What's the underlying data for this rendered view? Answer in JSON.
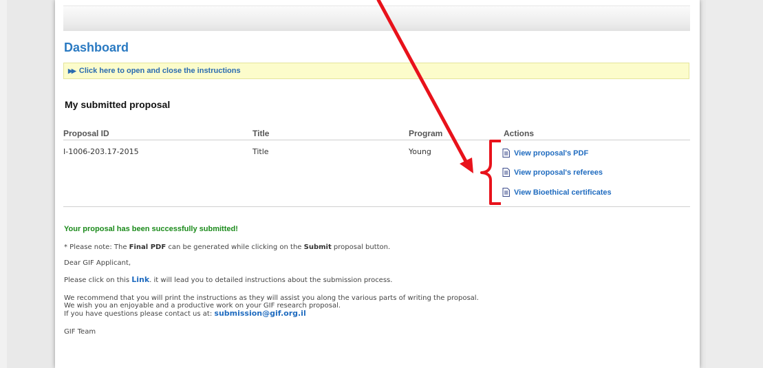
{
  "dashboard": {
    "title": "Dashboard",
    "instructions_toggle": "Click here to open and close the instructions"
  },
  "proposal_section": {
    "title": "My submitted proposal",
    "columns": [
      "Proposal ID",
      "Title",
      "Program",
      "Actions"
    ],
    "row": {
      "id": "I-1006-203.17-2015",
      "title": "Title",
      "program": "Young"
    },
    "actions": [
      {
        "label": "View proposal's PDF",
        "icon": "document-icon"
      },
      {
        "label": "View proposal's referees",
        "icon": "document-icon"
      },
      {
        "label": "View Bioethical certificates",
        "icon": "document-icon"
      }
    ]
  },
  "messages": {
    "success": "Your proposal has been successfully submitted!",
    "note_prefix": "* Please note: The ",
    "note_final_pdf": "Final PDF",
    "note_middle": " can be generated while clicking on the ",
    "note_submit": "Submit",
    "note_suffix": " proposal button.",
    "greeting": "Dear GIF Applicant,",
    "click_prefix": "Please click on this ",
    "click_link": "Link",
    "click_suffix": ". it will lead you to detailed instructions about the submission process.",
    "recommend_line1": "We recommend that you will print the instructions as they will assist you along the various parts of writing the proposal.",
    "recommend_line2": "We wish you an enjoyable and a productive work on your GIF research proposal.",
    "contact_prefix": "If you have questions please contact us at: ",
    "contact_email": "submission@gif.org.il",
    "signature": "GIF Team"
  },
  "colors": {
    "title_blue": "#2a7ac2",
    "link_blue": "#1f6bbf",
    "success_green": "#1a8a1a",
    "annotation_red": "#e8121b",
    "instructions_bg": "#fcfccb"
  }
}
